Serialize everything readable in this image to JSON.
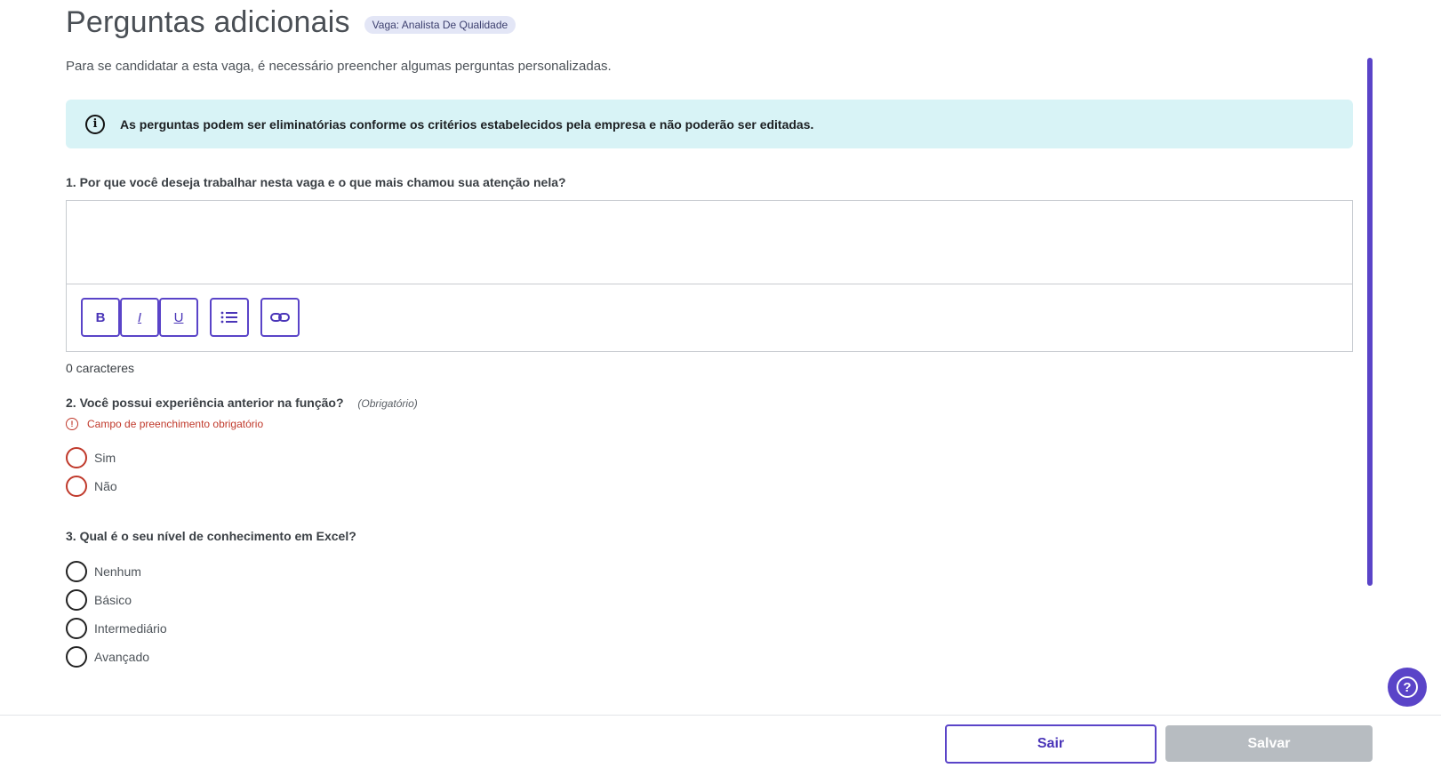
{
  "header": {
    "title": "Perguntas adicionais",
    "vaga_badge": "Vaga: Analista De Qualidade",
    "subtitle": "Para se candidatar a esta vaga, é necessário preencher algumas perguntas personalizadas."
  },
  "info_box": {
    "icon": "info-icon",
    "icon_glyph": "i",
    "text": "As perguntas podem ser eliminatórias conforme os critérios estabelecidos pela empresa e não poderão ser editadas."
  },
  "questions": [
    {
      "label": "1. Por que você deseja trabalhar nesta vaga e o que mais chamou sua atenção nela?",
      "type": "text",
      "value": "",
      "char_count": "0 caracteres",
      "toolbar": {
        "bold": "B",
        "italic": "I",
        "underline": "U"
      }
    },
    {
      "label": "2. Você possui experiência anterior na função?",
      "optional_tag": "(Obrigatório)",
      "error": "Campo de preenchimento obrigatório",
      "error_glyph": "!",
      "options": [
        "Sim",
        "Não"
      ]
    },
    {
      "label": "3. Qual é o seu nível de conhecimento em Excel?",
      "options": [
        "Nenhum",
        "Básico",
        "Intermediário",
        "Avançado"
      ]
    }
  ],
  "footer": {
    "sair_label": "Sair",
    "salvar_label": "Salvar"
  },
  "help": {
    "glyph": "?"
  },
  "colors": {
    "accent": "#5a44c8",
    "error": "#c0392b",
    "info_bg": "#d8f3f6",
    "disabled": "#b7bcc1"
  }
}
